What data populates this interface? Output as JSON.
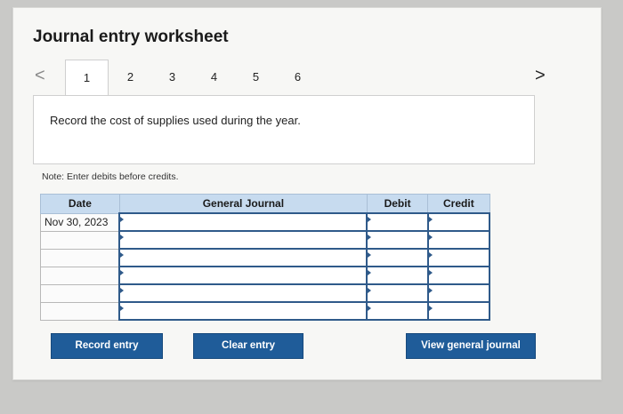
{
  "worksheet": {
    "title": "Journal entry worksheet",
    "prev_arrow": "<",
    "next_arrow": ">",
    "tabs": [
      "1",
      "2",
      "3",
      "4",
      "5",
      "6"
    ],
    "active_tab": "1",
    "instruction": "Record the cost of supplies used during the year.",
    "note": "Note: Enter debits before credits."
  },
  "journal": {
    "headers": {
      "date": "Date",
      "general_journal": "General Journal",
      "debit": "Debit",
      "credit": "Credit"
    },
    "rows": [
      {
        "date": "Nov 30, 2023",
        "account": "",
        "debit": "",
        "credit": ""
      },
      {
        "date": "",
        "account": "",
        "debit": "",
        "credit": ""
      },
      {
        "date": "",
        "account": "",
        "debit": "",
        "credit": ""
      },
      {
        "date": "",
        "account": "",
        "debit": "",
        "credit": ""
      },
      {
        "date": "",
        "account": "",
        "debit": "",
        "credit": ""
      },
      {
        "date": "",
        "account": "",
        "debit": "",
        "credit": ""
      }
    ]
  },
  "buttons": {
    "record": "Record entry",
    "clear": "Clear entry",
    "view": "View general journal"
  },
  "colors": {
    "header_bg": "#c7dbef",
    "button_bg": "#1f5c99",
    "input_border": "#2f5a8a"
  }
}
